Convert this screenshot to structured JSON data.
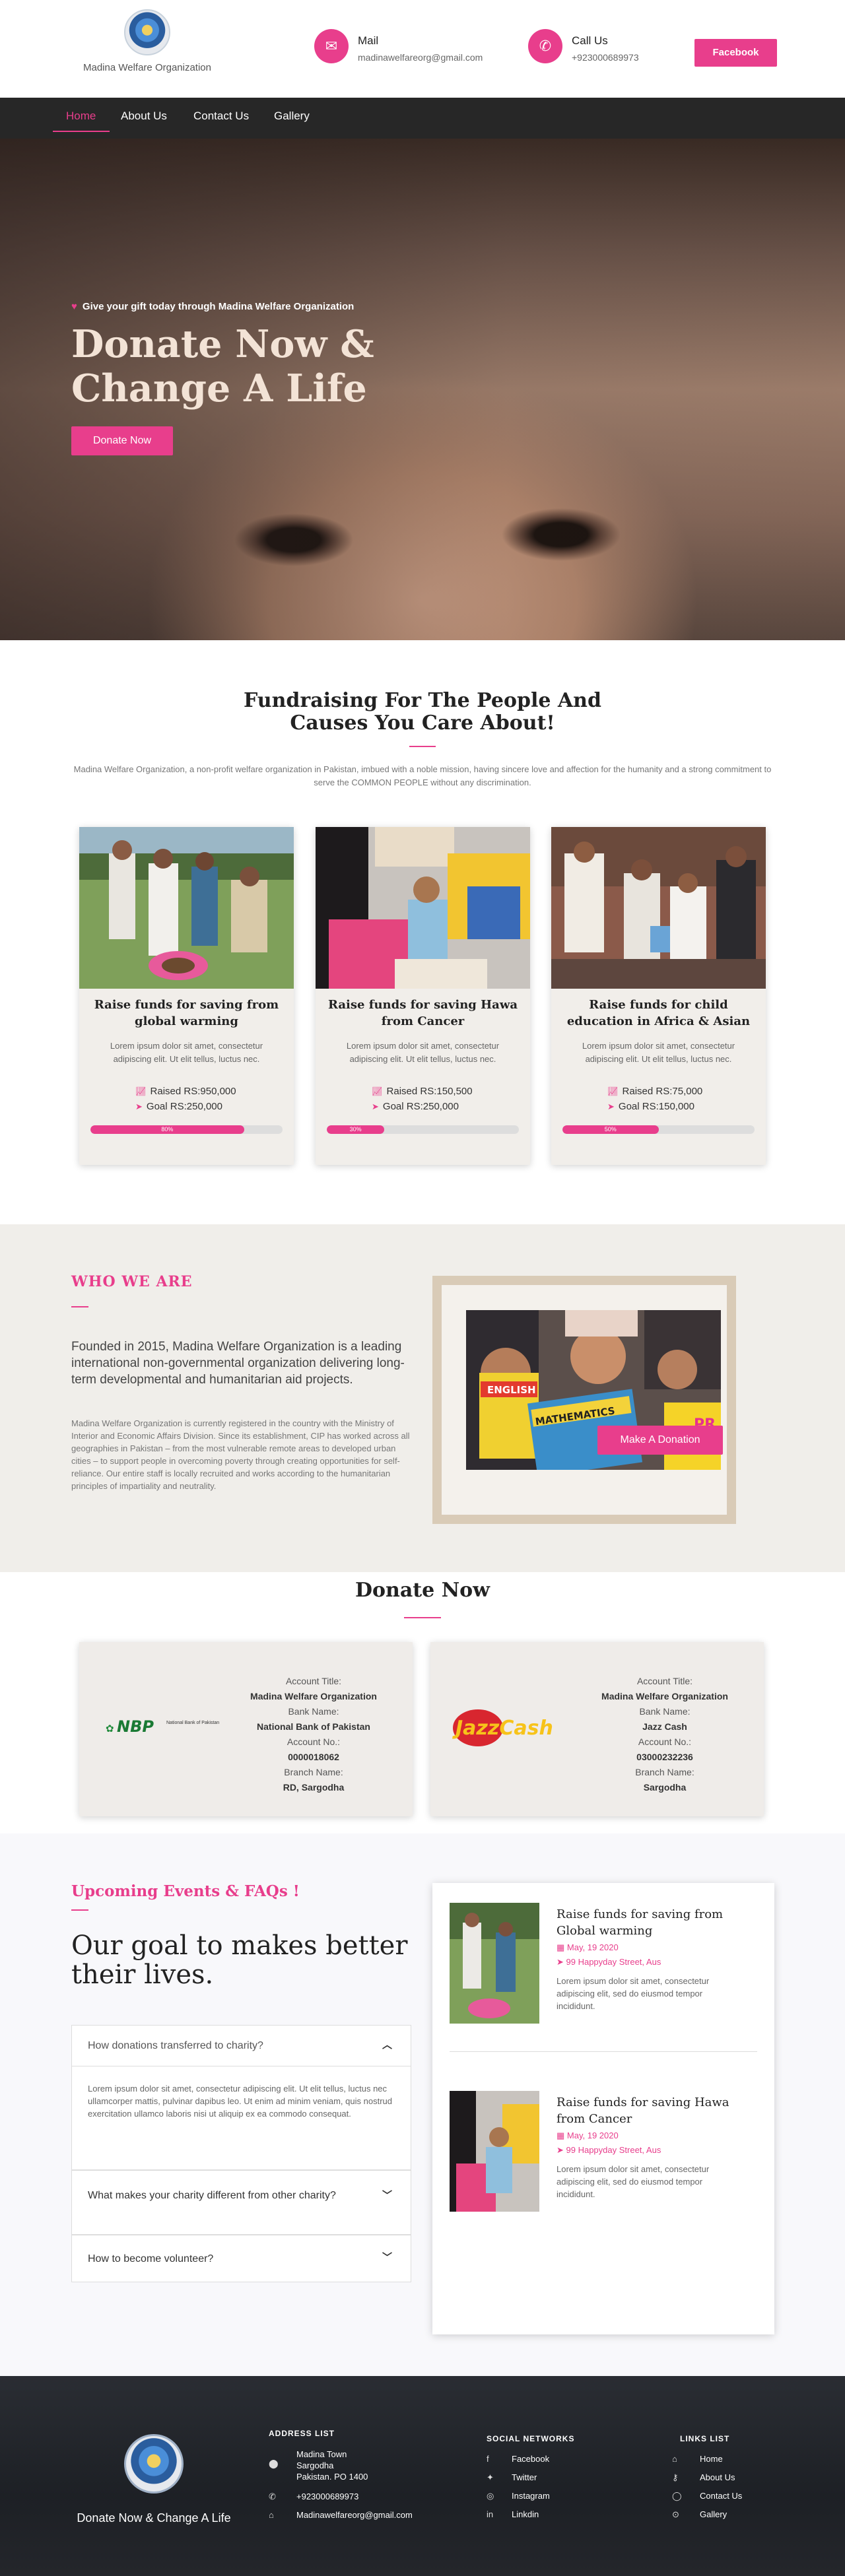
{
  "header": {
    "logo_text": "Madina Welfare Organization",
    "mail_label": "Mail",
    "mail_value": "madinawelfareorg@gmail.com",
    "call_label": "Call Us",
    "call_value": "+923000689973",
    "facebook_button": "Facebook"
  },
  "nav": {
    "items": [
      "Home",
      "About Us",
      "Contact Us",
      "Gallery"
    ],
    "active": "Home"
  },
  "hero": {
    "tagline": "Give your gift today through Madina Welfare Organization",
    "title": "Donate Now & Change A Life",
    "button": "Donate Now"
  },
  "causes": {
    "title": "Fundraising For The People And Causes You Care About!",
    "description": "Madina Welfare Organization, a non-profit welfare organization in Pakistan, imbued with a noble mission, having sincere love and affection for the humanity and a strong commitment to serve the COMMON PEOPLE without any discrimination.",
    "cards": [
      {
        "title": "Raise funds for saving from global warming",
        "desc": "Lorem ipsum dolor sit amet, consectetur adipiscing elit. Ut elit tellus, luctus nec.",
        "raised": "Raised RS:950,000",
        "goal": "Goal RS:250,000",
        "progress_label": "80%",
        "progress": 0.8
      },
      {
        "title": "Raise funds for saving Hawa from Cancer",
        "desc": "Lorem ipsum dolor sit amet, consectetur adipiscing elit. Ut elit tellus, luctus nec.",
        "raised": "Raised RS:150,500",
        "goal": "Goal RS:250,000",
        "progress_label": "30%",
        "progress": 0.3
      },
      {
        "title": "Raise funds for child education in Africa & Asian",
        "desc": "Lorem ipsum dolor sit amet, consectetur adipiscing elit. Ut elit tellus, luctus nec.",
        "raised": "Raised RS:75,000",
        "goal": "Goal RS:150,000",
        "progress_label": "50%",
        "progress": 0.5
      }
    ]
  },
  "who": {
    "heading": "WHO WE ARE",
    "lead": "Founded in 2015, Madina Welfare Organization is a leading international non-governmental organization delivering long-term developmental and humanitarian aid projects.",
    "body": "Madina Welfare Organization is currently registered in the country with the Ministry of Interior and Economic Affairs Division. Since its establishment, CIP has worked across all geographies in Pakistan – from the most vulnerable remote areas to developed urban cities – to support people in overcoming poverty through creating opportunities for self-reliance. Our entire staff is locally recruited and works according to the humanitarian principles of impartiality and neutrality.",
    "photo_texts": [
      "ENGLISH",
      "MATHEMATICS",
      "PR"
    ],
    "button": "Make A Donation"
  },
  "donate": {
    "title": "Donate Now",
    "banks": [
      {
        "logo": "NBP",
        "logo_sub": "National Bank of Pakistan",
        "title_label": "Account Title:",
        "title_value": "Madina Welfare Organization",
        "bank_label": "Bank Name:",
        "bank_value": "National Bank of Pakistan",
        "account_label": "Account No.:",
        "account_value": "0000018062",
        "branch_label": "Branch Name:",
        "branch_value": "RD, Sargodha"
      },
      {
        "logo": "JazzCash",
        "title_label": "Account Title:",
        "title_value": "Madina Welfare Organization",
        "bank_label": "Bank Name:",
        "bank_value": "Jazz Cash",
        "account_label": "Account No.:",
        "account_value": "03000232236",
        "branch_label": "Branch Name:",
        "branch_value": "Sargodha"
      }
    ]
  },
  "events": {
    "subtitle": "Upcoming Events & FAQs !",
    "title": "Our goal to makes better their lives.",
    "faqs": [
      {
        "q": "How donations transferred to charity?",
        "a": "Lorem ipsum dolor sit amet, consectetur adipiscing elit. Ut elit tellus, luctus nec ullamcorper mattis, pulvinar dapibus leo. Ut enim ad minim veniam, quis nostrud exercitation ullamco laboris nisi ut aliquip ex ea commodo consequat.",
        "open": true
      },
      {
        "q": "What makes your charity different from other charity?",
        "open": false
      },
      {
        "q": "How to become volunteer?",
        "open": false
      }
    ],
    "items": [
      {
        "title": "Raise funds for saving from Global warming",
        "date": "May, 19 2020",
        "place": "99 Happyday Street, Aus",
        "desc": "Lorem ipsum dolor sit amet, consectetur adipiscing elit, sed do eiusmod tempor incididunt."
      },
      {
        "title": "Raise funds for saving Hawa from Cancer",
        "date": "May, 19 2020",
        "place": "99 Happyday Street, Aus",
        "desc": "Lorem ipsum dolor sit amet, consectetur adipiscing elit, sed do eiusmod tempor incididunt."
      }
    ]
  },
  "footer": {
    "slogan": "Donate Now & Change A Life",
    "address_title": "ADDRESS LIST",
    "address": [
      "Madina Town",
      "Sargodha",
      "Pakistan. PO 1400"
    ],
    "phone": "+923000689973",
    "email": "Madinawelfareorg@gmail.com",
    "social_title": "SOCIAL NETWORKS",
    "social": [
      "Facebook",
      "Twitter",
      "Instagram",
      "Linkdin"
    ],
    "links_title": "LINKS LIST",
    "links": [
      "Home",
      "About Us",
      "Contact Us",
      "Gallery"
    ]
  },
  "colors": {
    "accent": "#e83e8c",
    "nav_bg": "#272727",
    "footer_bg": "#1f2227"
  }
}
